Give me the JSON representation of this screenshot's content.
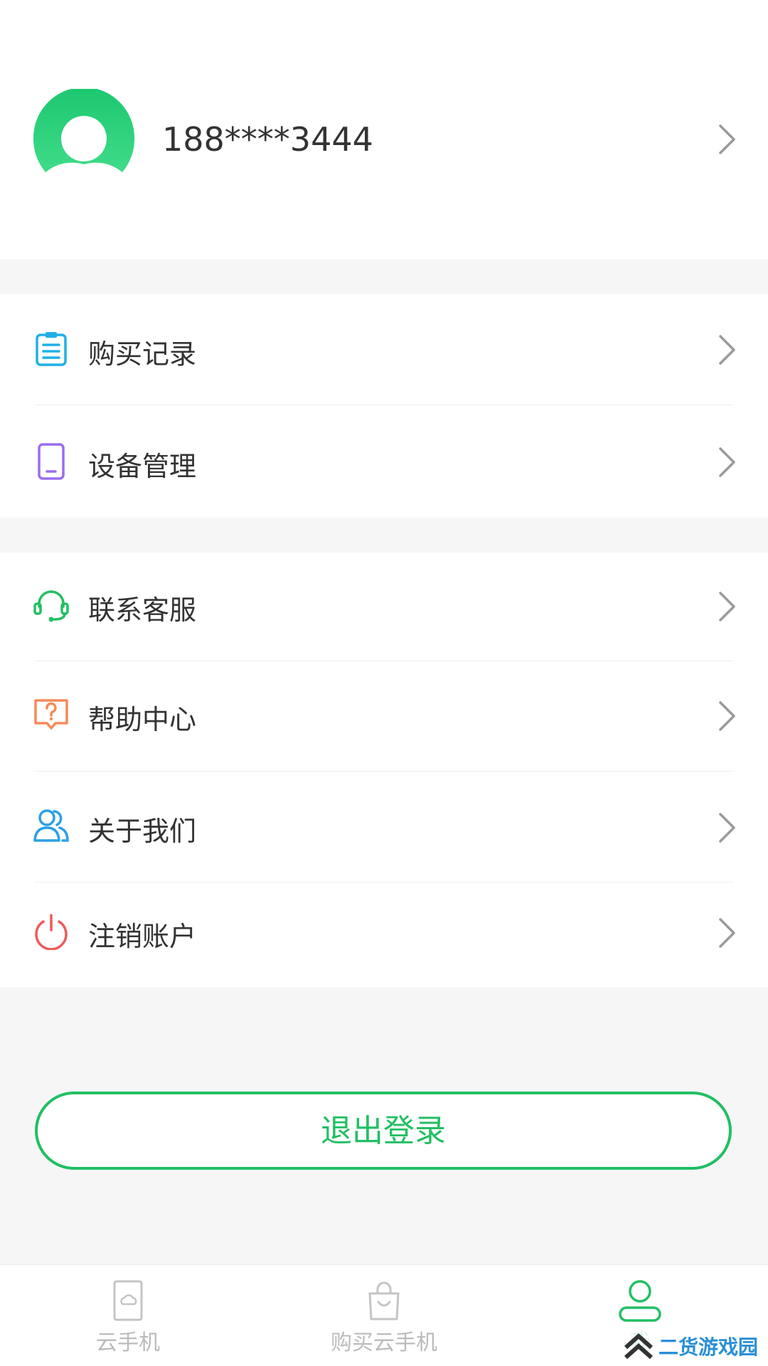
{
  "profile": {
    "phone": "188****3444"
  },
  "menu_group_1": [
    {
      "label": "购买记录",
      "icon": "clipboard-icon"
    },
    {
      "label": "设备管理",
      "icon": "phone-device-icon"
    }
  ],
  "menu_group_2": [
    {
      "label": "联系客服",
      "icon": "headset-icon"
    },
    {
      "label": "帮助中心",
      "icon": "help-question-icon"
    },
    {
      "label": "关于我们",
      "icon": "users-icon"
    },
    {
      "label": "注销账户",
      "icon": "power-icon"
    }
  ],
  "logout_label": "退出登录",
  "tabbar": {
    "tabs": [
      {
        "label": "云手机",
        "icon": "cloud-phone-icon",
        "active": false
      },
      {
        "label": "购买云手机",
        "icon": "shopping-bag-icon",
        "active": false
      },
      {
        "label": "我",
        "icon": "user-icon",
        "active": true
      }
    ]
  },
  "watermark": {
    "text": "二货游戏园"
  },
  "colors": {
    "accent": "#22bf63",
    "clipboard_icon": "#1fb0e6",
    "device_icon": "#9b6cf0",
    "headset_icon": "#22bf63",
    "help_icon": "#f58a5a",
    "about_icon": "#2a9fe6",
    "power_icon": "#ef5a5a"
  }
}
